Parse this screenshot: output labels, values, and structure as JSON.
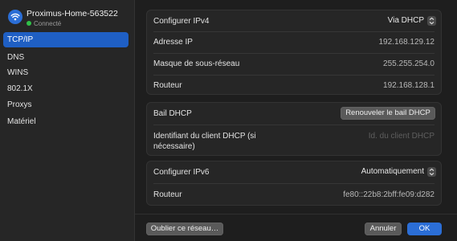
{
  "network": {
    "name": "Proximus-Home-563522",
    "status": "Connecté"
  },
  "sidebar": {
    "items": [
      {
        "label": "TCP/IP",
        "active": true
      },
      {
        "label": "DNS"
      },
      {
        "label": "WINS"
      },
      {
        "label": "802.1X"
      },
      {
        "label": "Proxys"
      },
      {
        "label": "Matériel"
      }
    ]
  },
  "ipv4": {
    "configure_label": "Configurer IPv4",
    "configure_value": "Via DHCP",
    "ip_label": "Adresse IP",
    "ip_value": "192.168.129.12",
    "mask_label": "Masque de sous-réseau",
    "mask_value": "255.255.254.0",
    "router_label": "Routeur",
    "router_value": "192.168.128.1"
  },
  "dhcp": {
    "lease_label": "Bail DHCP",
    "renew_button": "Renouveler le bail DHCP",
    "client_id_label": "Identifiant du client DHCP (si nécessaire)",
    "client_id_placeholder": "Id. du client DHCP"
  },
  "ipv6": {
    "configure_label": "Configurer IPv6",
    "configure_value": "Automatiquement",
    "router_label": "Routeur",
    "router_value": "fe80::22b8:2bff:fe09:d282"
  },
  "footer": {
    "forget_button": "Oublier ce réseau…",
    "cancel_button": "Annuler",
    "ok_button": "OK"
  },
  "colors": {
    "accent": "#2b6ed6",
    "sidebar_selected": "#1f5fc4",
    "connected": "#30c048"
  },
  "icons": {
    "network": "wifi-icon",
    "popup": "updown-chevron-icon"
  }
}
